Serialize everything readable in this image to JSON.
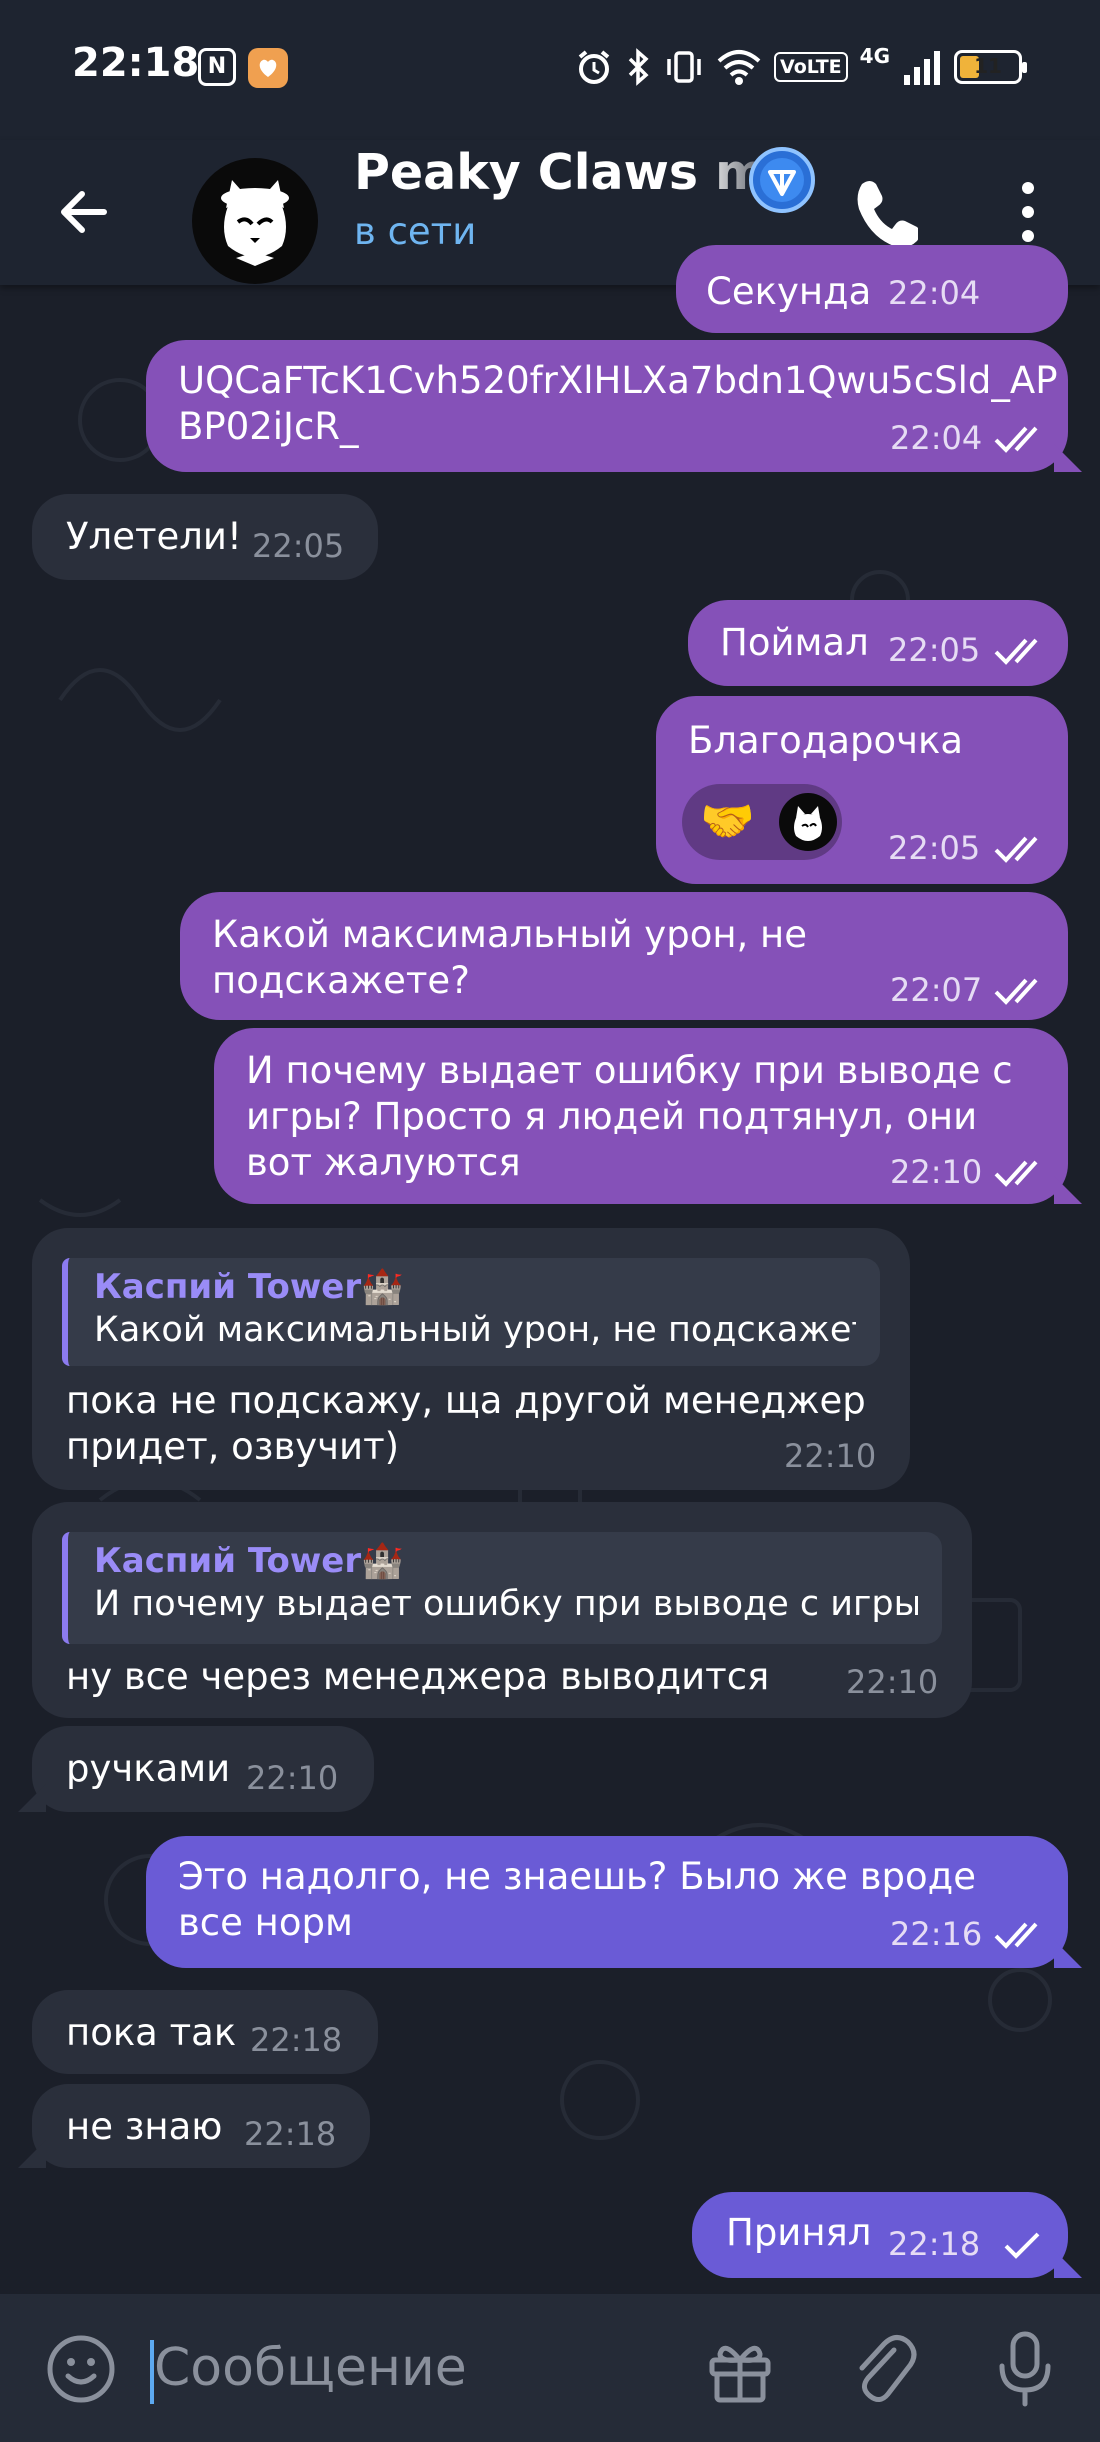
{
  "status_bar": {
    "time": "22:18",
    "nfc": "N",
    "network": "4G",
    "volte": "VoLTE",
    "battery": "11"
  },
  "header": {
    "title": "Peaky Claws ma",
    "status": "в сети"
  },
  "messages": [
    {
      "text": "Секунда",
      "time": "22:04"
    },
    {
      "text": "UQCaFTcK1Cvh520frXlHLXa7bdn1Qwu5cSld_APBP02iJcR_",
      "time": "22:04"
    },
    {
      "text": "Улетели!",
      "time": "22:05"
    },
    {
      "text": "Поймал",
      "time": "22:05"
    },
    {
      "text": "Благодарочка",
      "time": "22:05",
      "reaction": "🤝"
    },
    {
      "text": "Какой максимальный урон, не подскажете?",
      "time": "22:07"
    },
    {
      "text": "И почему выдает ошибку при выводе с игры? Просто я людей подтянул, они вот жалуются",
      "time": "22:10"
    },
    {
      "reply_name": "Каспий Tower🏰",
      "reply_text": "Какой максимальный урон, не подскажете?",
      "text": "пока не подскажу, ща другой менеджер придет, озвучит)",
      "time": "22:10"
    },
    {
      "reply_name": "Каспий Tower🏰",
      "reply_text": "И почему выдает ошибку при выводе с игры?...",
      "text": "ну все через менеджера выводится",
      "time": "22:10"
    },
    {
      "text": "ручками",
      "time": "22:10"
    },
    {
      "text": "Это надолго, не знаешь? Было же вроде все норм",
      "time": "22:16"
    },
    {
      "text": "пока так",
      "time": "22:18"
    },
    {
      "text": "не знаю",
      "time": "22:18"
    },
    {
      "text": "Принял",
      "time": "22:18"
    }
  ],
  "input": {
    "placeholder": "Сообщение"
  },
  "colors": {
    "outgoing": "#8551b8",
    "outgoing_latest": "#6a5bd6",
    "incoming": "#2a2f3b",
    "accent": "#6fb5f0"
  }
}
